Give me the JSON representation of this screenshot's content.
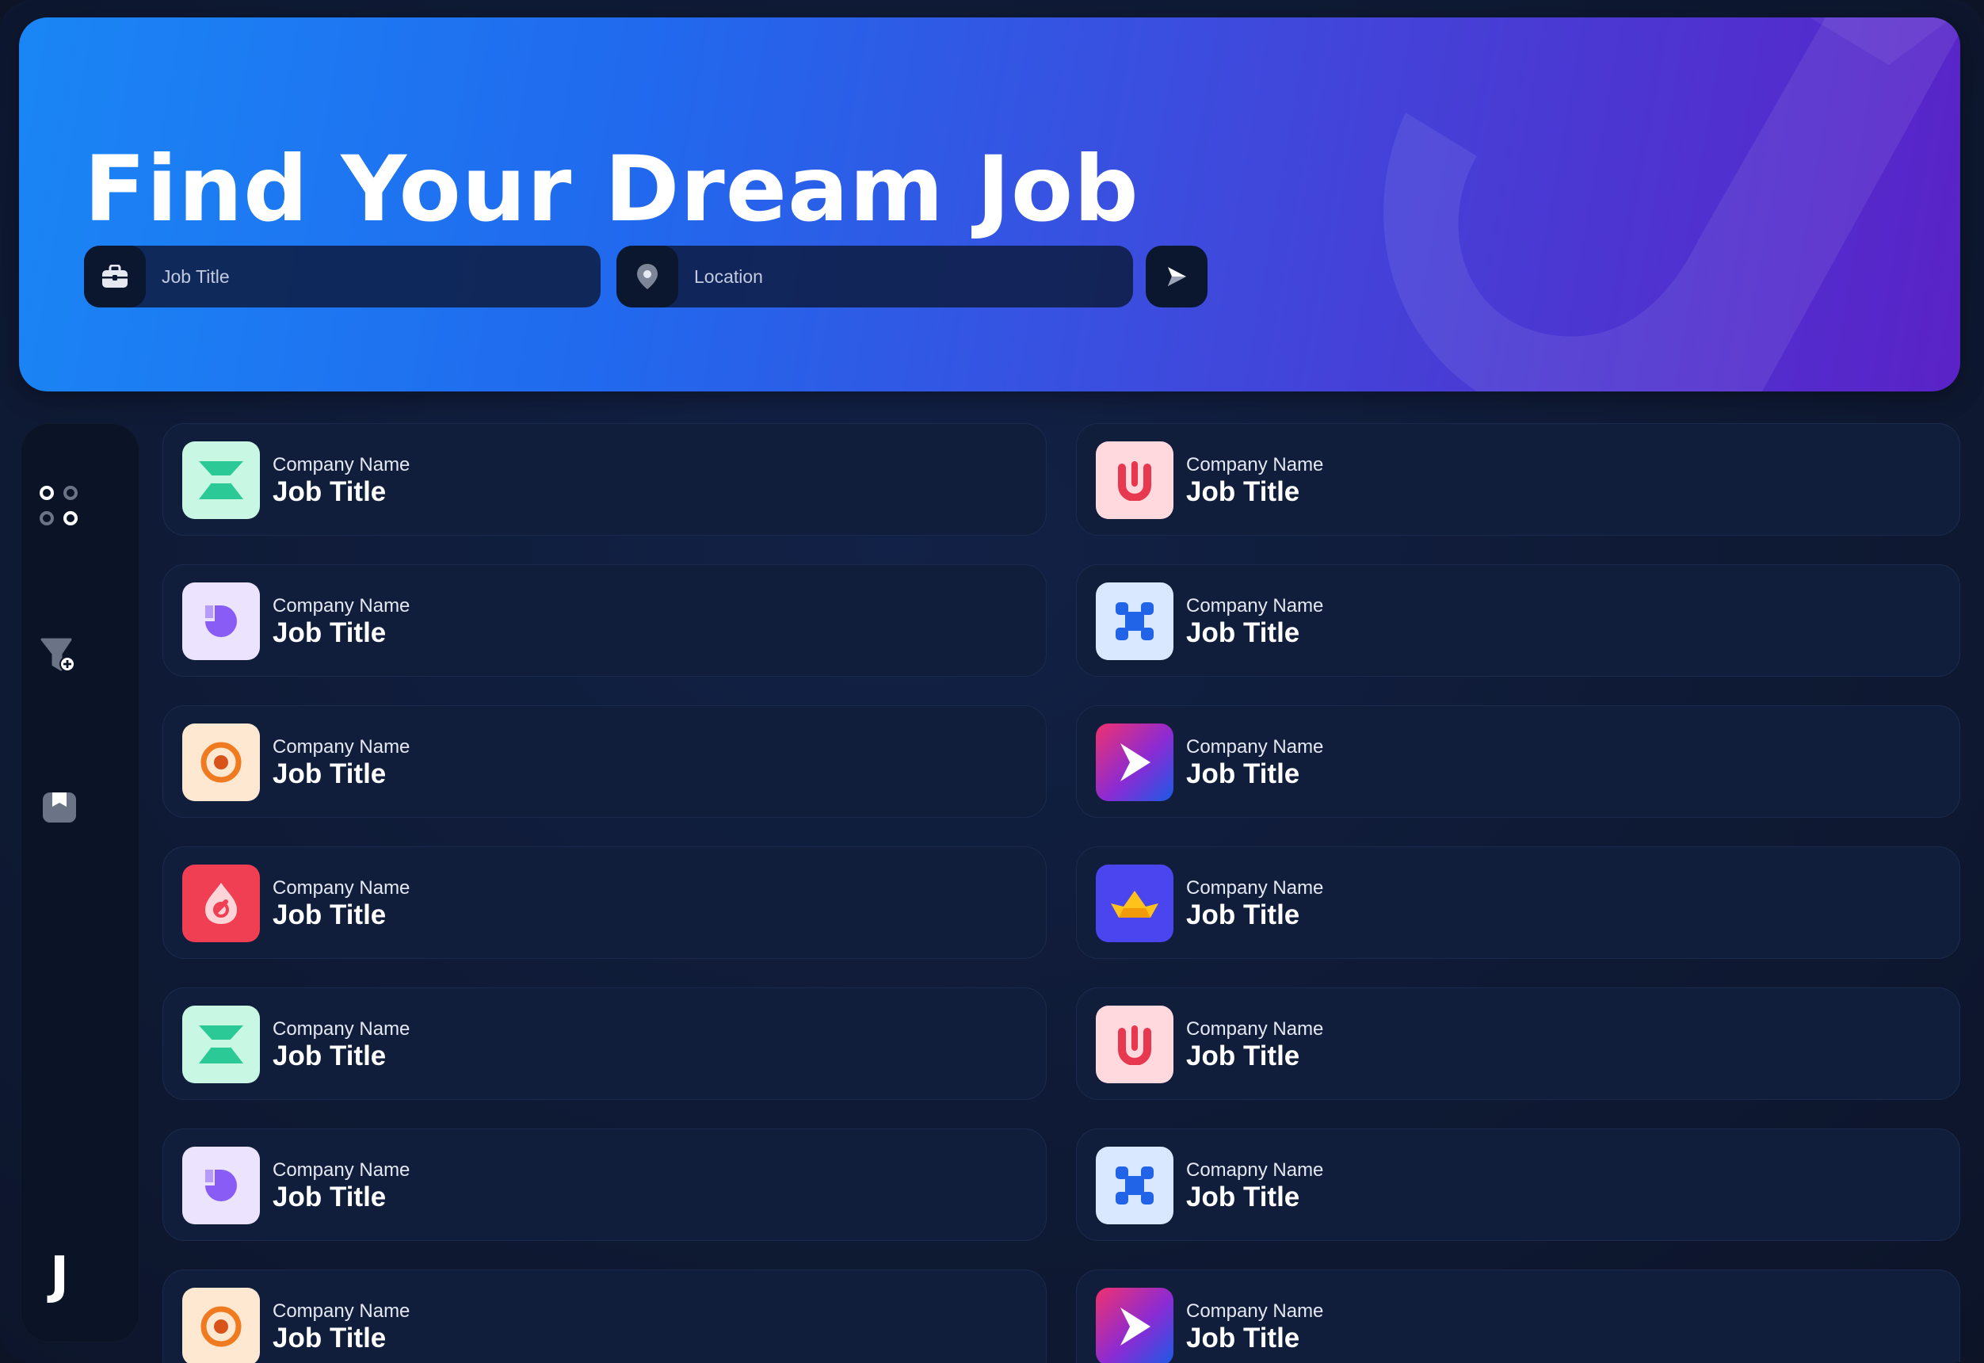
{
  "hero": {
    "title": "Find Your Dream Job",
    "job_title_placeholder": "Job Title",
    "location_placeholder": "Location",
    "job_title_icon": "briefcase-icon",
    "location_icon": "map-pin-icon",
    "submit_icon": "send-arrow-icon"
  },
  "sidebar": {
    "items": [
      {
        "name": "dashboard",
        "icon": "grid-dots-icon"
      },
      {
        "name": "filter",
        "icon": "filter-add-icon"
      },
      {
        "name": "saved",
        "icon": "bookmark-icon"
      }
    ],
    "brand": "J"
  },
  "jobs": [
    {
      "company": "Company Name",
      "title": "Job Title",
      "logo": "hourglass-logo"
    },
    {
      "company": "Company Name",
      "title": "Job Title",
      "logo": "u-letter-logo"
    },
    {
      "company": "Company Name",
      "title": "Job Title",
      "logo": "pie-logo"
    },
    {
      "company": "Company Name",
      "title": "Job Title",
      "logo": "cross-nodes-logo"
    },
    {
      "company": "Company Name",
      "title": "Job Title",
      "logo": "target-ring-logo"
    },
    {
      "company": "Company Name",
      "title": "Job Title",
      "logo": "play-arrow-logo"
    },
    {
      "company": "Company Name",
      "title": "Job Title",
      "logo": "drop-link-logo"
    },
    {
      "company": "Company Name",
      "title": "Job Title",
      "logo": "crown-boat-logo"
    },
    {
      "company": "Company Name",
      "title": "Job Title",
      "logo": "hourglass-logo"
    },
    {
      "company": "Company Name",
      "title": "Job Title",
      "logo": "u-letter-logo"
    },
    {
      "company": "Company Name",
      "title": "Job Title",
      "logo": "pie-logo"
    },
    {
      "company": "Comapny Name",
      "title": "Job Title",
      "logo": "cross-nodes-logo"
    },
    {
      "company": "Company Name",
      "title": "Job Title",
      "logo": "target-ring-logo"
    },
    {
      "company": "Company Name",
      "title": "Job Title",
      "logo": "play-arrow-logo"
    }
  ],
  "colors": {
    "hero_start": "#1a86f5",
    "hero_end": "#5a22c7",
    "card_bg": "#101e3b",
    "page_bg": "#0f1b37"
  }
}
